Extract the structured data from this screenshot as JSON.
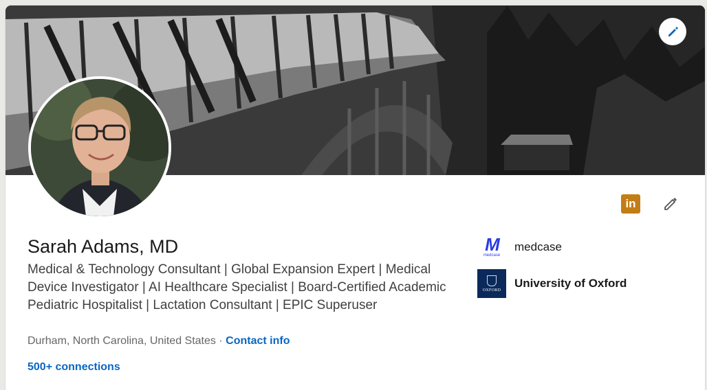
{
  "profile": {
    "name": "Sarah Adams, MD",
    "headline": "Medical & Technology Consultant | Global Expansion Expert | Medical Device Investigator | AI Healthcare Specialist | Board-Certified Academic Pediatric Hospitalist | Lactation Consultant | EPIC Superuser",
    "location": "Durham, North Carolina, United States",
    "separator": "·",
    "contact_label": "Contact info",
    "connections": "500+ connections"
  },
  "organizations": [
    {
      "name": "medcase",
      "logo_text": "M",
      "logo_subtext": "medcase"
    },
    {
      "name": "University of Oxford",
      "logo_text": "OXFORD"
    }
  ],
  "actions": {
    "linkedin_badge": "in",
    "edit_banner_icon": "pencil-icon",
    "edit_profile_icon": "pencil-icon"
  },
  "colors": {
    "link": "#0a66c2",
    "linkedin_badge": "#c37d16",
    "medcase_brand": "#2b3be0",
    "oxford_brand": "#0b2a5b"
  }
}
